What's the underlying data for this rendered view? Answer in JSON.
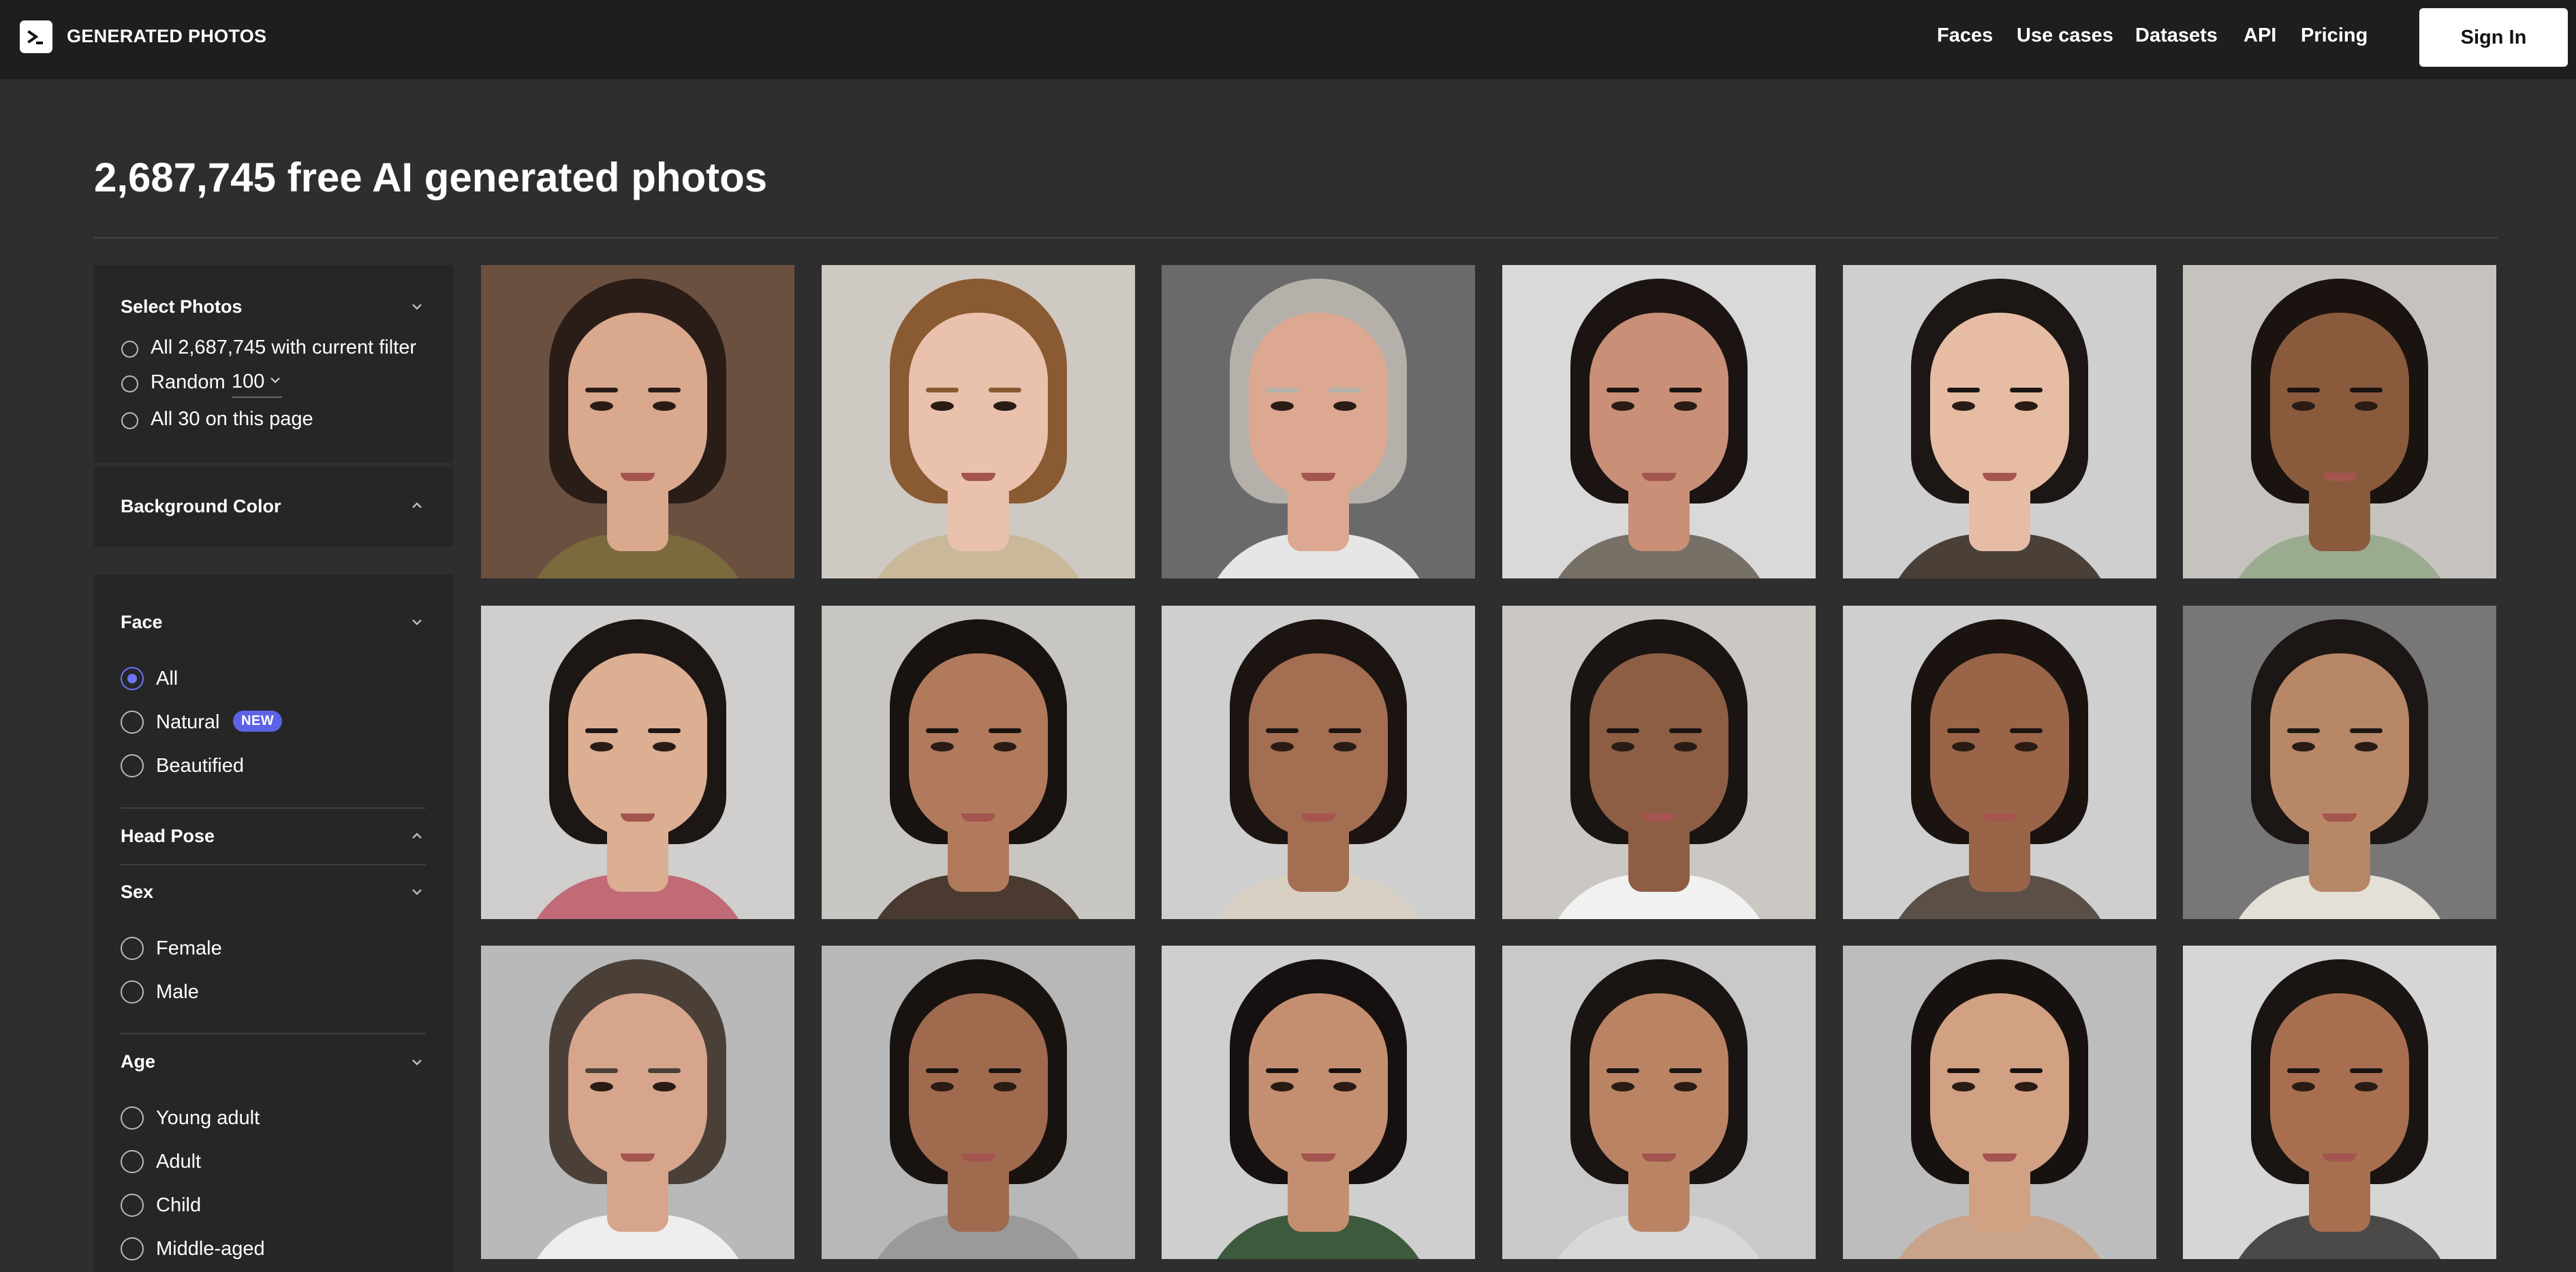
{
  "header": {
    "brand": "GENERATED PHOTOS",
    "nav": [
      "Faces",
      "Use cases",
      "Datasets",
      "API",
      "Pricing"
    ],
    "signin_label": "Sign In"
  },
  "page": {
    "title": "2,687,745 free AI generated photos"
  },
  "sidebar": {
    "select_photos": {
      "title": "Select Photos",
      "options": [
        "All 2,687,745 with current filter",
        "Random",
        "All 30 on this page"
      ],
      "random_count": "100"
    },
    "background_color": {
      "title": "Background Color"
    },
    "face": {
      "title": "Face",
      "options": [
        "All",
        "Natural",
        "Beautified"
      ],
      "selected": "All",
      "new_badge": "NEW"
    },
    "head_pose": {
      "title": "Head Pose"
    },
    "sex": {
      "title": "Sex",
      "options": [
        "Female",
        "Male"
      ]
    },
    "age": {
      "title": "Age",
      "options": [
        "Young adult",
        "Adult",
        "Child",
        "Middle-aged"
      ]
    }
  },
  "photos": [
    {
      "bg": "#6b5040",
      "skin": "#d9a88d",
      "hair": "#2a1d17",
      "shirt": "#7a6a3e"
    },
    {
      "bg": "#cfc9c3",
      "skin": "#e9c1ac",
      "hair": "#8a5a32",
      "shirt": "#c9b89a"
    },
    {
      "bg": "#6a6a6a",
      "skin": "#dca892",
      "hair": "#b5b1aa",
      "shirt": "#e6e6e6"
    },
    {
      "bg": "#d9d9d9",
      "skin": "#c99077",
      "hair": "#1b1412",
      "shirt": "#777066"
    },
    {
      "bg": "#cfcfcf",
      "skin": "#e6bda4",
      "hair": "#1c1614",
      "shirt": "#4a4038"
    },
    {
      "bg": "#c6c3bf",
      "skin": "#8a5a3d",
      "hair": "#1a1310",
      "shirt": "#9aab8f"
    },
    {
      "bg": "#d0cfcd",
      "skin": "#dcae92",
      "hair": "#1c1614",
      "shirt": "#c06b76"
    },
    {
      "bg": "#c8c6c2",
      "skin": "#b17a5c",
      "hair": "#181210",
      "shirt": "#4a3a30"
    },
    {
      "bg": "#cfcfcf",
      "skin": "#a46e52",
      "hair": "#1b1411",
      "shirt": "#d9d0c4"
    },
    {
      "bg": "#cbc7c2",
      "skin": "#8d5e44",
      "hair": "#1a1412",
      "shirt": "#f1f1f1"
    },
    {
      "bg": "#cfcfcf",
      "skin": "#9a6448",
      "hair": "#1a1310",
      "shirt": "#5a5048"
    },
    {
      "bg": "#777777",
      "skin": "#b88768",
      "hair": "#1c1614",
      "shirt": "#e4e0d8"
    },
    {
      "bg": "#b9b9b9",
      "skin": "#d6a58c",
      "hair": "#4a4038",
      "shirt": "#eeeeee"
    },
    {
      "bg": "#b8b8b8",
      "skin": "#a06a4f",
      "hair": "#191310",
      "shirt": "#9a9a9a"
    },
    {
      "bg": "#cfcfcf",
      "skin": "#c48f70",
      "hair": "#161110",
      "shirt": "#3d5a3c"
    },
    {
      "bg": "#c9c9c9",
      "skin": "#ba8464",
      "hair": "#1a1412",
      "shirt": "#d8d8d8"
    },
    {
      "bg": "#bdbdbd",
      "skin": "#d2a083",
      "hair": "#171210",
      "shirt": "#c9a48a"
    },
    {
      "bg": "#d6d6d6",
      "skin": "#a76f50",
      "hair": "#1a1412",
      "shirt": "#4c4a48"
    }
  ]
}
